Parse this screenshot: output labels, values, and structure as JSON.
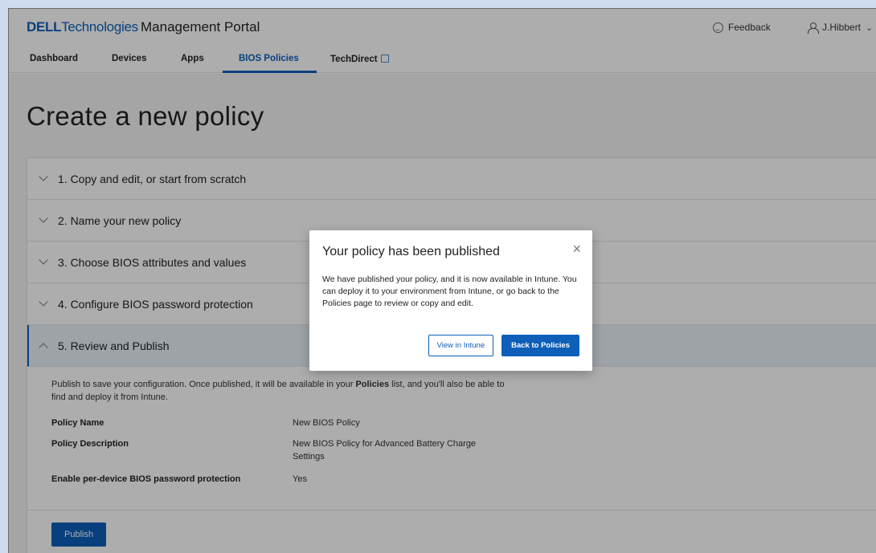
{
  "header": {
    "logo_dell": "DELL",
    "logo_tech": "Technologies",
    "portal_title": "Management Portal",
    "feedback_label": "Feedback",
    "user_label": "J.Hibbert"
  },
  "tabs": [
    {
      "label": "Dashboard",
      "active": false
    },
    {
      "label": "Devices",
      "active": false
    },
    {
      "label": "Apps",
      "active": false
    },
    {
      "label": "BIOS Policies",
      "active": true
    },
    {
      "label": "TechDirect",
      "active": false,
      "external": true
    }
  ],
  "page": {
    "title": "Create a new policy"
  },
  "steps": [
    {
      "label": "1. Copy and edit, or start from scratch",
      "expanded": false
    },
    {
      "label": "2. Name your new policy",
      "expanded": false
    },
    {
      "label": "3. Choose BIOS attributes and values",
      "expanded": false
    },
    {
      "label": "4. Configure BIOS password protection",
      "expanded": false
    },
    {
      "label": "5. Review and Publish",
      "expanded": true
    }
  ],
  "review": {
    "desc_before": "Publish to save your configuration. Once published, it will be available in your ",
    "desc_bold": "Policies",
    "desc_after": " list, and you'll also be able to find and deploy it from Intune.",
    "rows": [
      {
        "key": "Policy Name",
        "value": "New BIOS Policy"
      },
      {
        "key": "Policy Description",
        "value": "New BIOS Policy for Advanced Battery Charge Settings"
      },
      {
        "key": "Enable per-device BIOS password protection",
        "value": "Yes"
      }
    ],
    "publish_label": "Publish"
  },
  "modal": {
    "title": "Your policy has been published",
    "body": "We have published your policy, and it is now available in Intune. You can deploy it to your environment from Intune, or go back to the Policies page to review or copy and edit.",
    "close_glyph": "×",
    "view_intune_label": "View in Intune",
    "back_label": "Back to Policies"
  },
  "colors": {
    "accent": "#0d5fb8",
    "overlay": "rgba(0,0,0,0.32)"
  }
}
